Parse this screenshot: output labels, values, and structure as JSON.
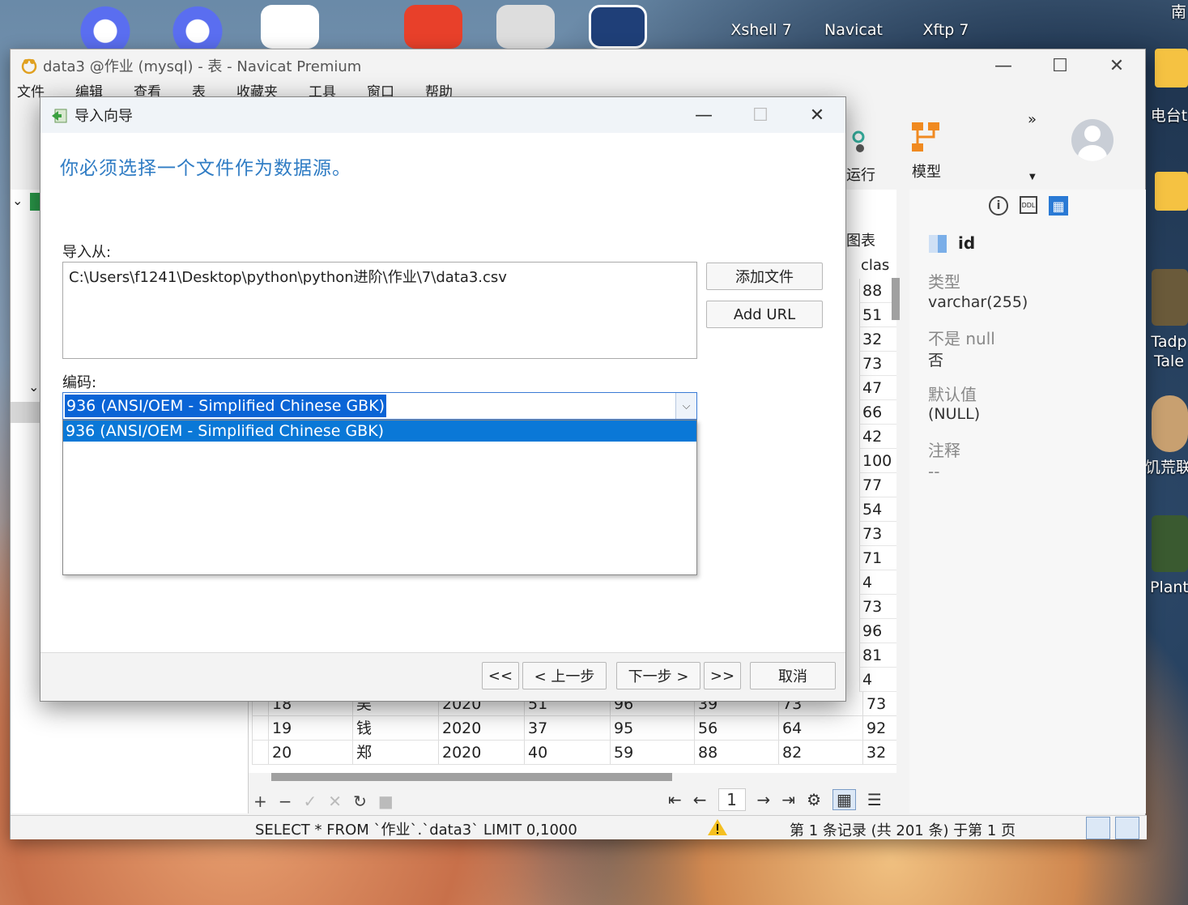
{
  "desktop": {
    "icons": [
      {
        "label": "Xshell 7"
      },
      {
        "label": "Navicat"
      },
      {
        "label": "Xftp 7"
      },
      {
        "label": "南"
      },
      {
        "label": "电台t"
      },
      {
        "label": "Tadp Tale"
      },
      {
        "label": "饥荒联"
      },
      {
        "label": "Plants"
      }
    ]
  },
  "main_window": {
    "title": "data3 @作业 (mysql) - 表 - Navicat Premium",
    "menu": [
      "文件",
      "编辑",
      "查看",
      "表",
      "收藏夹",
      "工具",
      "窗口",
      "帮助"
    ],
    "toolbar": {
      "run_label": "运行",
      "model_label": "模型",
      "more": "»"
    },
    "grid": {
      "chart_tab": "图表",
      "col_head": "clas",
      "clas_values": [
        "88",
        "51",
        "32",
        "73",
        "47",
        "66",
        "42",
        "100",
        "77",
        "54",
        "73",
        "71",
        "4",
        "73",
        "96",
        "81",
        "4"
      ],
      "rows": [
        [
          "18",
          "吴",
          "2020",
          "51",
          "96",
          "39",
          "73",
          "73"
        ],
        [
          "19",
          "钱",
          "2020",
          "37",
          "95",
          "56",
          "64",
          "92"
        ],
        [
          "20",
          "郑",
          "2020",
          "40",
          "59",
          "88",
          "82",
          "32"
        ]
      ]
    },
    "pager": {
      "page": "1"
    },
    "status": {
      "sql": "SELECT * FROM `作业`.`data3` LIMIT 0,1000",
      "records": "第 1 条记录 (共 201 条) 于第 1 页"
    },
    "right_panel": {
      "field_name": "id",
      "type_label": "类型",
      "type_value": "varchar(255)",
      "notnull_label": "不是 null",
      "notnull_value": "否",
      "default_label": "默认值",
      "default_value": "(NULL)",
      "comment_label": "注释",
      "comment_value": "--"
    }
  },
  "dialog": {
    "title": "导入向导",
    "heading": "你必须选择一个文件作为数据源。",
    "import_from_label": "导入从:",
    "file_path": "C:\\Users\\f1241\\Desktop\\python\\python进阶\\作业\\7\\data3.csv",
    "add_file_button": "添加文件",
    "add_url_button": "Add URL",
    "encoding_label": "编码:",
    "encoding_value": "936 (ANSI/OEM - Simplified Chinese GBK)",
    "encoding_options": [
      "936 (ANSI/OEM - Simplified Chinese GBK)"
    ],
    "footer": {
      "first": "<<",
      "prev": "< 上一步",
      "next": "下一步 >",
      "last": ">>",
      "cancel": "取消"
    }
  }
}
